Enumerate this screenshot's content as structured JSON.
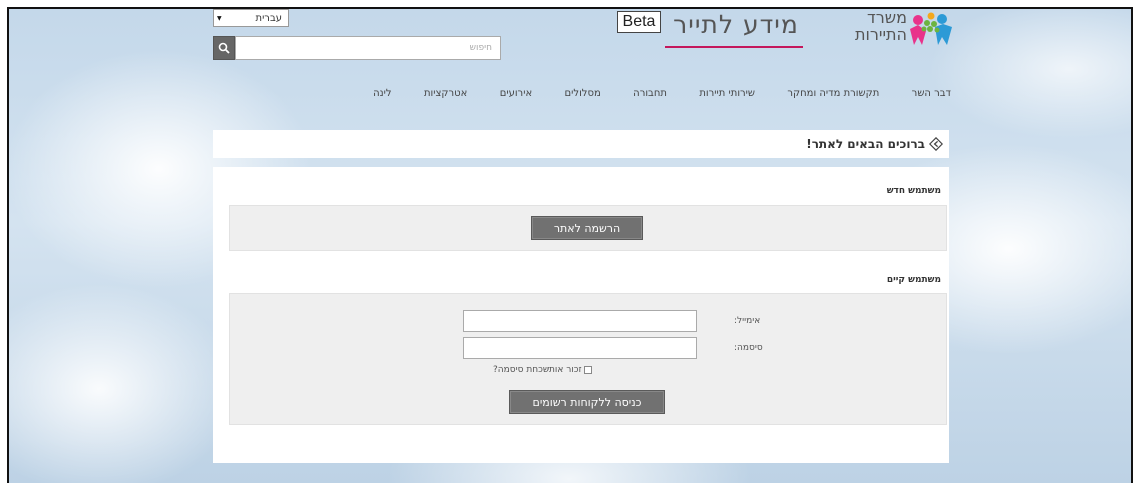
{
  "header": {
    "language_selected": "עברית",
    "search_placeholder": "חיפוש",
    "beta_label": "Beta",
    "site_name": "מידע לתייר",
    "ministry_line1": "משרד",
    "ministry_line2": "התיירות"
  },
  "nav": {
    "items": [
      "לינה",
      "אטרקציות",
      "אירועים",
      "מסלולים",
      "תחבורה",
      "שירותי תיירות",
      "תקשורת מדיה ומחקר",
      "דבר השר"
    ]
  },
  "welcome": {
    "text": "ברוכים הבאים לאתר!"
  },
  "new_user": {
    "title": "משתמש חדש",
    "register_button": "הרשמה לאתר"
  },
  "existing_user": {
    "title": "משתמש קיים",
    "email_label": "אימייל:",
    "email_value": "",
    "password_label": "סיסמה:",
    "password_value": "",
    "remember_label": "זכור אותי",
    "forgot_label": "שכחת סיסמה?",
    "login_button": "כניסה ללקוחות רשומים"
  },
  "colors": {
    "accent_underline": "#c4175c",
    "button_bg": "#717171",
    "logo_colors": [
      "#e8338b",
      "#2c9ad6",
      "#f4a81d",
      "#6cb43f"
    ]
  }
}
